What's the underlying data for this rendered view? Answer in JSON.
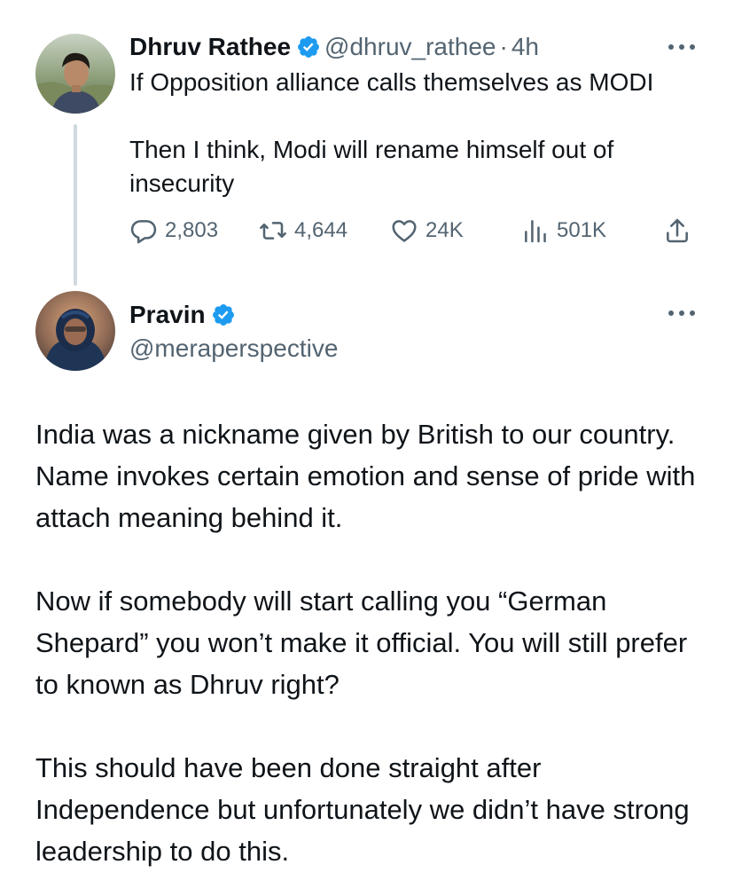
{
  "parent_tweet": {
    "author_name": "Dhruv Rathee",
    "handle": "@dhruv_rathee",
    "separator": "·",
    "time": "4h",
    "text_paragraphs": [
      "If Opposition alliance calls themselves as MODI",
      "Then I think, Modi will rename himself out of insecurity"
    ],
    "actions": {
      "replies": "2,803",
      "reposts": "4,644",
      "likes": "24K",
      "views": "501K"
    },
    "icons": {
      "verified": "verified-badge-icon",
      "more": "more-options-icon",
      "reply": "reply-icon",
      "repost": "repost-icon",
      "like": "heart-icon",
      "views": "views-chart-icon",
      "share": "share-icon"
    }
  },
  "reply_tweet": {
    "author_name": "Pravin",
    "handle": "@meraperspective",
    "text_paragraphs": [
      "India was a nickname given by British to our country. Name invokes certain emotion and sense of pride with attach meaning behind it.",
      "Now if somebody will start calling you “German Shepard” you won’t make it official. You will still prefer to known as  Dhruv right?",
      "This should have been done straight after Independence but unfortunately we didn’t have strong leadership to do this."
    ]
  },
  "colors": {
    "text_primary": "#0f1419",
    "text_secondary": "#536471",
    "verified_blue": "#1d9bf0",
    "thread_line": "#cfd9de"
  }
}
